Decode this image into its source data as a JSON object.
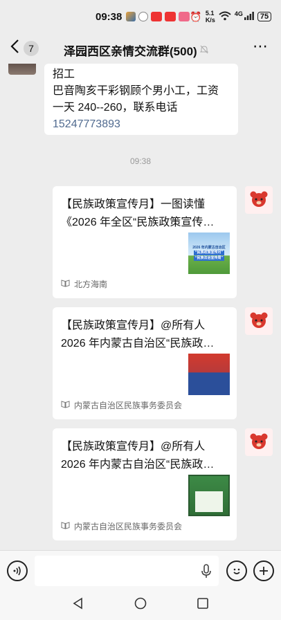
{
  "status": {
    "time": "09:38",
    "net_speed_top": "5.1",
    "net_speed_bottom": "K/s",
    "network": "4G",
    "battery": "75"
  },
  "header": {
    "back_count": "7",
    "title": "泽园西区亲情交流群(500)"
  },
  "messages": {
    "first": {
      "line1": "招工",
      "line2": "巴音陶亥干彩钢顾个男小工，工资",
      "line3": "一天 240--260，联系电话",
      "phone": "15247773893"
    },
    "timestamp": "09:38",
    "cards": [
      {
        "title_line1": "【民族政策宣传月】一图读懂",
        "title_line2": "《2026 年全区“民族政策宣传…",
        "source": "北方海南",
        "thumb_line1": "2026 年内蒙古自治区",
        "thumb_line2": "“民族政策宣传月”",
        "thumb_line3": "“民族法治宣传周”"
      },
      {
        "title_line1": "【民族政策宣传月】@所有人",
        "title_line2": "2026 年内蒙古自治区“民族政…",
        "source": "内蒙古自治区民族事务委员会"
      },
      {
        "title_line1": "【民族政策宣传月】@所有人",
        "title_line2": "2026 年内蒙古自治区“民族政…",
        "source": "内蒙古自治区民族事务委员会"
      }
    ]
  },
  "colors": {
    "background": "#ededed",
    "bubble": "#ffffff",
    "link": "#506a8f"
  }
}
